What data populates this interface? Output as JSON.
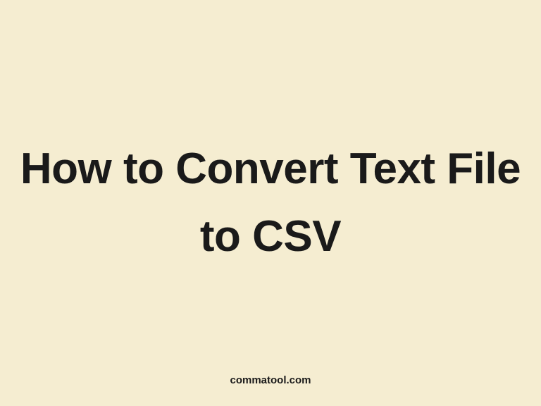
{
  "title": "How to Convert Text File to CSV",
  "footer": "commatool.com",
  "colors": {
    "background": "#f5edd1",
    "text": "#1a1a1a"
  }
}
